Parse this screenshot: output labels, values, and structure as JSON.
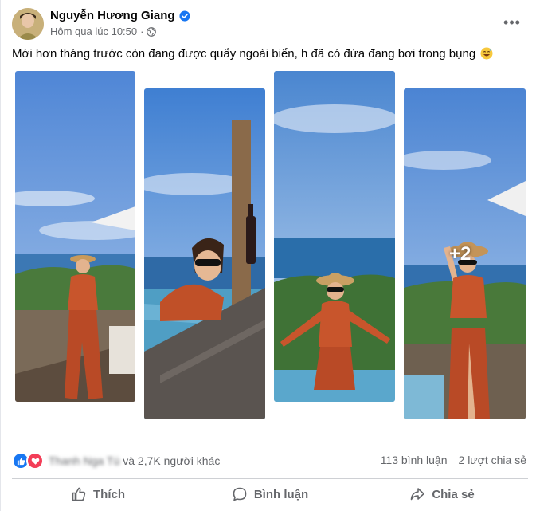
{
  "post": {
    "author": "Nguyễn Hương Giang",
    "timestamp": "Hôm qua lúc 10:50",
    "separator": "·",
    "caption": "Mới hơn tháng trước còn đang được quẩy ngoài biển, h đã có đứa đang bơi trong bụng",
    "caption_emoji": "grinning-sweat-emoji",
    "more_label": "•••"
  },
  "gallery": {
    "extra_count": "+2"
  },
  "stats": {
    "reaction_names_blurred": "Thanh Nga Tú",
    "reaction_suffix": "và 2,7K người khác",
    "comments": "113 bình luận",
    "shares": "2 lượt chia sẻ"
  },
  "actions": {
    "like": "Thích",
    "comment": "Bình luận",
    "share": "Chia sẻ"
  },
  "colors": {
    "accent": "#1877f2",
    "love": "#f33e58",
    "secondary_text": "#65676b",
    "divider": "#ced0d4"
  },
  "icons": [
    "verified-badge-icon",
    "globe-icon",
    "more-options-icon",
    "like-reaction-icon",
    "love-reaction-icon",
    "thumbs-up-icon",
    "comment-bubble-icon",
    "share-arrow-icon"
  ]
}
